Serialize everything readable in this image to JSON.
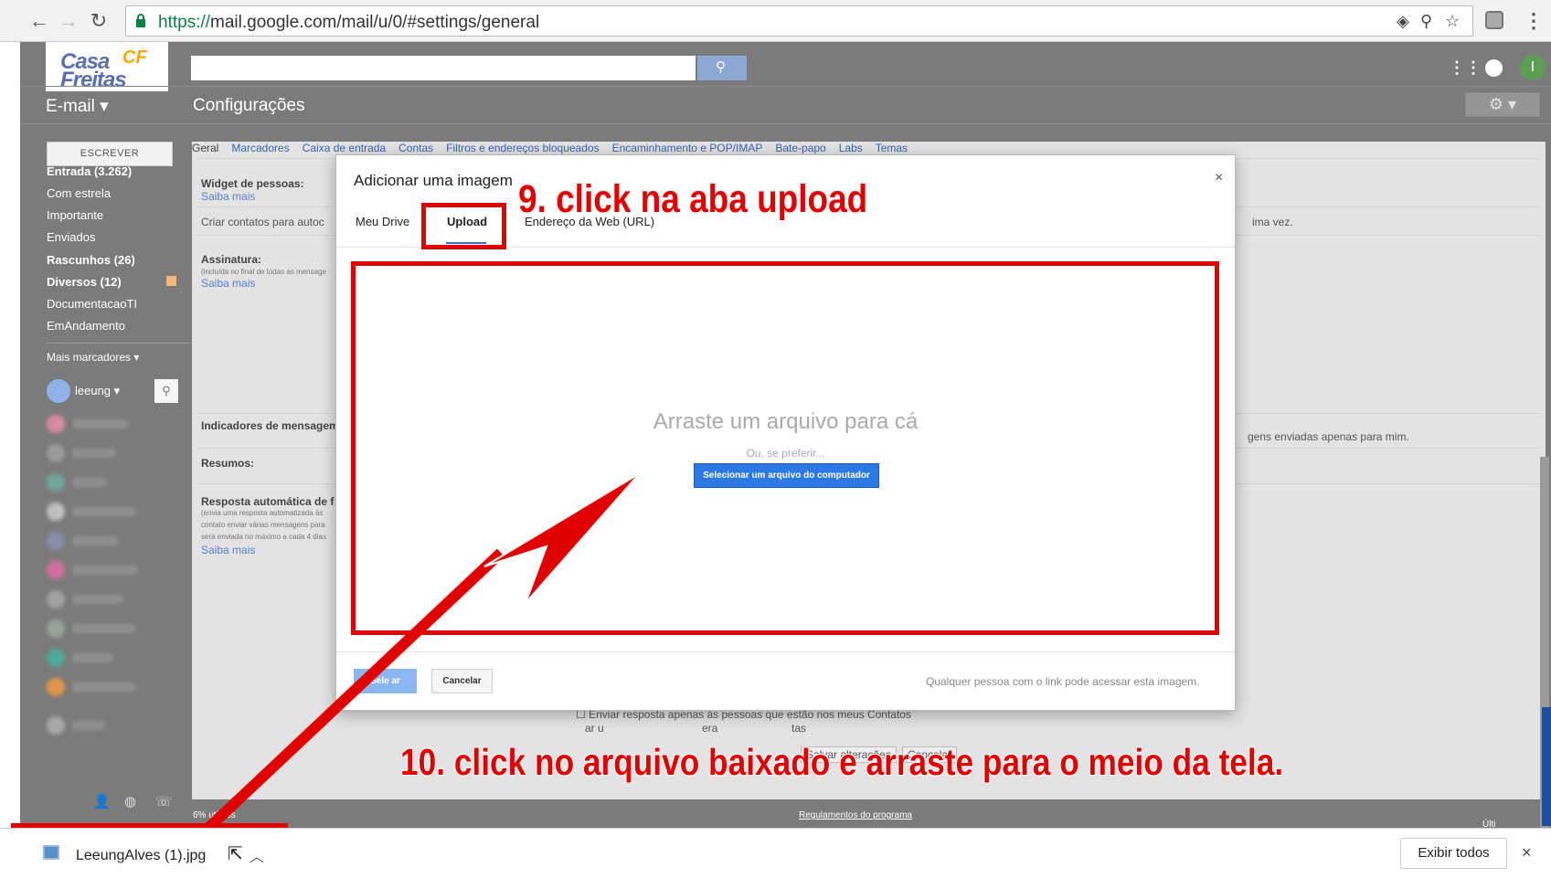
{
  "browser": {
    "url_scheme": "https://",
    "url_rest": "mail.google.com/mail/u/0/#settings/general"
  },
  "header": {
    "logo_line1": "Casa",
    "logo_line2": "Freitas",
    "logo_badge": "CF",
    "avatar_letter": "I",
    "mail_label": "E-mail ▾",
    "page_title": "Configurações",
    "gear_label": "⚙ ▾"
  },
  "sidebar": {
    "compose": "ESCREVER",
    "items": [
      "Entrada (3.262)",
      "Com estrela",
      "Importante",
      "Enviados",
      "Rascunhos (26)",
      "Diversos (12)",
      "DocumentacaoTI",
      "EmAndamento"
    ],
    "more": "Mais marcadores ▾",
    "user": "leeung ▾"
  },
  "settings": {
    "tabs": [
      "Geral",
      "Marcadores",
      "Caixa de entrada",
      "Contas",
      "Filtros e endereços bloqueados",
      "Encaminhamento e POP/IMAP",
      "Bate-papo",
      "Labs",
      "Temas"
    ],
    "widget": "Widget de pessoas:",
    "saiba": "Saiba mais",
    "criar": "Criar contatos para autoc",
    "criar_right": "ima vez.",
    "assinatura": "Assinatura:",
    "assinatura_note": "(incluída no final de todas as mensage",
    "indicadores": "Indicadores de mensagem",
    "indicadores_right": "gens enviadas apenas para mim.",
    "resumos": "Resumos:",
    "resposta": "Resposta automática de f",
    "resposta_note1": "(envia uma resposta automatizada às",
    "resposta_note2": "contato enviar várias mensagens para",
    "resposta_note3": "será enviada no máximo a cada 4 dias",
    "chk1": "Enviar resposta apenas às pessoas que estão nos meus Contatos",
    "chk2_a": "ar u",
    "chk2_b": "era",
    "chk2_c": "tas",
    "save": "Salvar alterações",
    "cancel": "Cancelar",
    "usage": "6% uti",
    "usage2": "dos",
    "rules": "Regulamentos do programa",
    "lastact": "Últi"
  },
  "dialog": {
    "title": "Adicionar uma imagem",
    "close": "×",
    "tabs": [
      "Meu Drive",
      "Upload",
      "Endereço da Web (URL)"
    ],
    "drop": "Arraste um arquivo para cá",
    "or": "Ou, se preferir...",
    "pick": "Selecionar um arquivo do computador",
    "select": "Sele  ar",
    "cancel": "Cancelar",
    "note": "Qualquer pessoa com o link pode acessar esta imagem."
  },
  "annotations": {
    "step9": "9. click na aba upload",
    "step10": "10. click no arquivo baixado e arraste para o meio da tela."
  },
  "downloads": {
    "file": "LeeungAlves (1).jpg",
    "show_all": "Exibir todos",
    "close": "×"
  },
  "colors": {
    "annotation": "#e10000",
    "gmail_bg": "#7b7b7b",
    "primary_button": "#2c79e6"
  }
}
